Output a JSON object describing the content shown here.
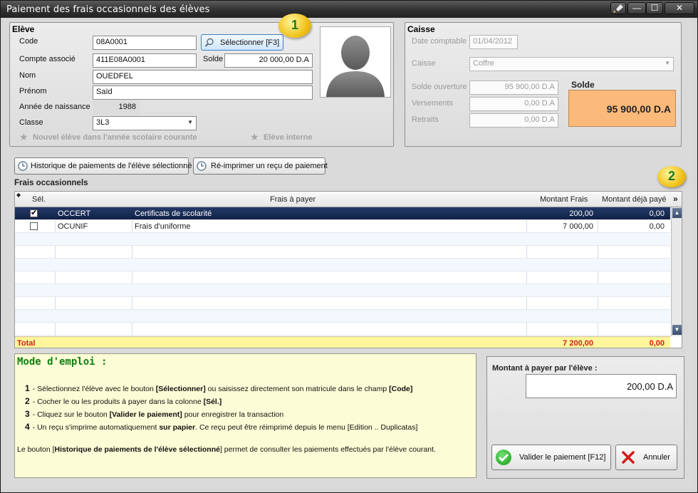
{
  "window": {
    "title": "Paiement des frais occasionnels des élèves",
    "buttons": {
      "close": "✕",
      "minimize": "—",
      "maximize": "☐"
    }
  },
  "eleve": {
    "group_title": "Elève",
    "code_label": "Code",
    "code_value": "08A0001",
    "select_button": "Sélectionner [F3]",
    "compte_label": "Compte associé",
    "compte_value": "411E08A0001",
    "solde_label": "Solde",
    "solde_value": "20 000,00 D.A",
    "nom_label": "Nom",
    "nom_value": "OUEDFEL",
    "prenom_label": "Prénom",
    "prenom_value": "Saïd",
    "annee_label": "Année de naissance",
    "annee_value": "1988",
    "classe_label": "Classe",
    "classe_value": "3L3",
    "nouvel_eleve": "Nouvel élève dans l'année scolaire courante",
    "eleve_interne": "Elève interne"
  },
  "caisse": {
    "group_title": "Caisse",
    "date_label": "Date comptable",
    "date_value": "01/04/2012",
    "caisse_label": "Caisse",
    "caisse_value": "Coffre",
    "solde_ouverture_label": "Solde ouverture",
    "solde_ouverture_value": "95 900,00 D.A",
    "versements_label": "Versements",
    "versements_value": "0,00 D.A",
    "retraits_label": "Retraits",
    "retraits_value": "0,00 D.A",
    "solde_title": "Solde",
    "solde_value": "95 900,00 D.A"
  },
  "toolbar": {
    "historique_button": "Historique de paiements de l'élève sélectionné",
    "reimprimer_button": "Ré-imprimer un reçu de paiement"
  },
  "balloons": {
    "one": "1",
    "two": "2"
  },
  "frais": {
    "section_title": "Frais occasionnels",
    "columns": {
      "sel": "Sél.",
      "frais": "Frais à payer",
      "montant": "Montant Frais",
      "deja_paye": "Montant déjà payé"
    },
    "rows": [
      {
        "checked": true,
        "code": "OCCERT",
        "label": "Certificats de scolarité",
        "montant": "200,00",
        "deja_paye": "0,00"
      },
      {
        "checked": false,
        "code": "OCUNIF",
        "label": "Frais d'uniforme",
        "montant": "7 000,00",
        "deja_paye": "0,00"
      }
    ],
    "total_label": "Total",
    "total_montant": "7 200,00",
    "total_deja_paye": "0,00"
  },
  "instructions": {
    "title": "Mode d'emploi :",
    "steps": [
      {
        "n": "1",
        "parts": [
          "- Sélectionnez l'élève avec le bouton ",
          "[Sélectionner]",
          " ou saisissez directement son matricule dans le champ ",
          "[Code]"
        ]
      },
      {
        "n": "2",
        "parts": [
          "- Cocher le ou les produits à payer dans la colonne ",
          "[Sél.]",
          "",
          ""
        ]
      },
      {
        "n": "3",
        "parts": [
          "- Cliquez sur le bouton ",
          "[Valider le paiement]",
          " pour enregistrer la transaction",
          ""
        ]
      },
      {
        "n": "4",
        "parts": [
          "- Un reçu s'imprime automatiquement ",
          "sur papier",
          ". Ce reçu peut être réimprimé depuis le menu [Edition .. Duplicatas]",
          ""
        ]
      }
    ],
    "footer_parts": [
      "Le bouton [",
      "Historique de paiements de l'élève sélectionné",
      "] permet de consulter les paiements effectués par l'élève courant."
    ]
  },
  "payment": {
    "label": "Montant à payer par l'élève :",
    "value": "200,00 D.A",
    "validate_button": "Valider le paiement [F12]",
    "cancel_button": "Annuler"
  },
  "colors": {
    "accent_total": "#d02020",
    "solde_bg": "#fbb97a",
    "selected_row": "#1a2d57"
  }
}
